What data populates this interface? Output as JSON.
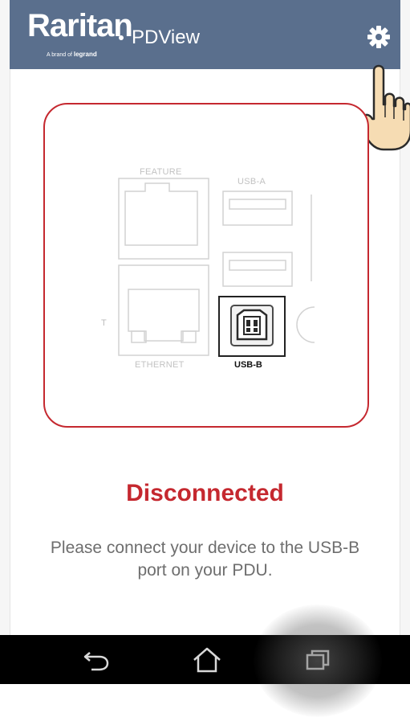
{
  "app_bar": {
    "brand_name": "Raritan",
    "brand_tagline_prefix": "A brand of",
    "brand_tagline_company": "legrand",
    "product_name": "PDView",
    "settings_icon": "gear-icon",
    "background_color": "#5a6f8d"
  },
  "ports_diagram": {
    "feature_label": "FEATURE",
    "usb_a_label": "USB-A",
    "ethernet_label": "ETHERNET",
    "usb_b_label": "USB-B",
    "left_edge_label": "T",
    "highlighted_port": "USB-B",
    "frame_color": "#c5282f"
  },
  "status": {
    "label": "Disconnected",
    "color": "#c5282f"
  },
  "message": {
    "text": "Please connect your device to the USB-B port on your PDU."
  },
  "pointer": {
    "icon": "pointing-hand-icon"
  },
  "nav_bar": {
    "back_icon": "back-icon",
    "home_icon": "home-icon",
    "recent_icon": "recent-apps-icon"
  }
}
